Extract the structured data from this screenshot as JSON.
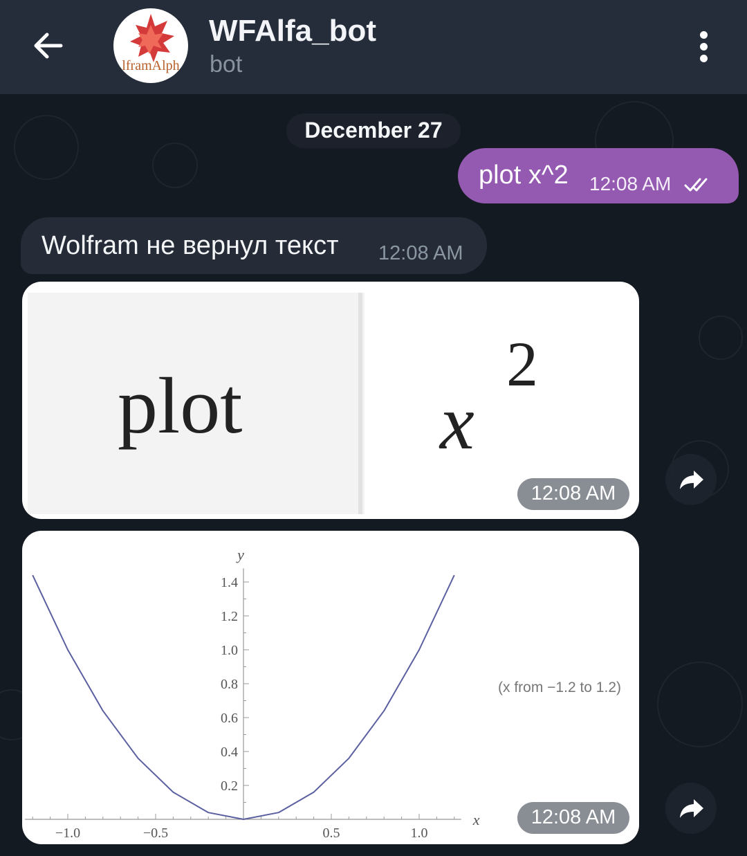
{
  "header": {
    "title": "WFAlfa_bot",
    "subtitle": "bot",
    "avatar_text": "lframAlph"
  },
  "date_separator": "December 27",
  "messages": [
    {
      "kind": "outgoing_text",
      "text": "plot x^2",
      "time": "12:08 AM",
      "read": true
    },
    {
      "kind": "incoming_text",
      "text": "Wolfram не вернул текст",
      "time": "12:08 AM"
    },
    {
      "kind": "incoming_image",
      "title_word": "plot",
      "expression": "x",
      "exponent": "2",
      "time": "12:08 AM"
    },
    {
      "kind": "incoming_plot",
      "range_note": "(x from −1.2 to 1.2)",
      "time": "12:08 AM"
    }
  ],
  "icons": {
    "back": "arrow-left-icon",
    "menu": "more-vert-icon",
    "forward": "forward-icon",
    "read_receipt": "double-check-icon"
  },
  "colors": {
    "header_bg": "#242d39",
    "chat_bg": "#141a22",
    "outgoing_bubble": "#9459b0",
    "incoming_bubble": "#252c38",
    "curve": "#5a5fa0"
  },
  "chart_data": {
    "type": "line",
    "x_ticks": [
      -1.0,
      -0.5,
      0.5,
      1.0
    ],
    "x_tick_labels": [
      "−1.0",
      "−0.5",
      "0.5",
      "1.0"
    ],
    "y_ticks": [
      0.2,
      0.4,
      0.6,
      0.8,
      1.0,
      1.2,
      1.4
    ],
    "y_tick_labels": [
      "0.2",
      "0.4",
      "0.6",
      "0.8",
      "1.0",
      "1.2",
      "1.4"
    ],
    "xlabel": "x",
    "ylabel": "y",
    "xlim": [
      -1.2,
      1.2
    ],
    "ylim": [
      0,
      1.44
    ],
    "series": [
      {
        "x": [
          -1.2,
          -1.0,
          -0.8,
          -0.6,
          -0.4,
          -0.2,
          0,
          0.2,
          0.4,
          0.6,
          0.8,
          1.0,
          1.2
        ],
        "y": [
          1.44,
          1.0,
          0.64,
          0.36,
          0.16,
          0.04,
          0,
          0.04,
          0.16,
          0.36,
          0.64,
          1.0,
          1.44
        ]
      }
    ]
  }
}
